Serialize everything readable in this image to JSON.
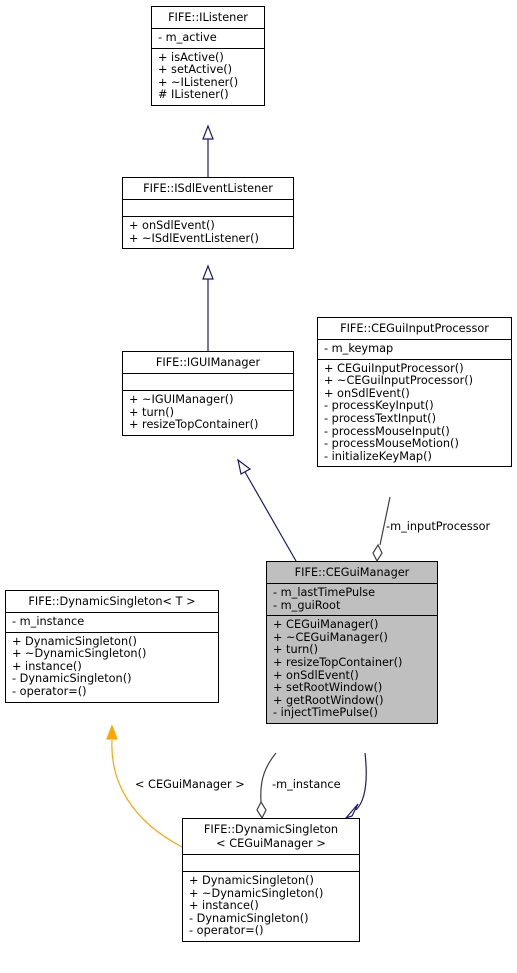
{
  "classes": {
    "ilistener": {
      "name": "FIFE::IListener",
      "attributes": [
        "- m_active"
      ],
      "methods": [
        "+ isActive()",
        "+ setActive()",
        "+ ~IListener()",
        "# IListener()"
      ]
    },
    "isdleventlistener": {
      "name": "FIFE::ISdlEventListener",
      "attributes": [],
      "methods": [
        "+ onSdlEvent()",
        "+ ~ISdlEventListener()"
      ]
    },
    "iguimanager": {
      "name": "FIFE::IGUIManager",
      "attributes": [],
      "methods": [
        "+ ~IGUIManager()",
        "+ turn()",
        "+ resizeTopContainer()"
      ]
    },
    "ceguiinputprocessor": {
      "name": "FIFE::CEGuiInputProcessor",
      "attributes": [
        "- m_keymap"
      ],
      "methods": [
        "+ CEGuiInputProcessor()",
        "+ ~CEGuiInputProcessor()",
        "+ onSdlEvent()",
        "- processKeyInput()",
        "- processTextInput()",
        "- processMouseInput()",
        "- processMouseMotion()",
        "- initializeKeyMap()"
      ]
    },
    "ceguimanager": {
      "name": "FIFE::CEGuiManager",
      "attributes": [
        "- m_lastTimePulse",
        "- m_guiRoot"
      ],
      "methods": [
        "+ CEGuiManager()",
        "+ ~CEGuiManager()",
        "+ turn()",
        "+ resizeTopContainer()",
        "+ onSdlEvent()",
        "+ setRootWindow()",
        "+ getRootWindow()",
        "- injectTimePulse()"
      ]
    },
    "dynamicsingleton_t": {
      "name": "FIFE::DynamicSingleton< T >",
      "attributes": [
        "- m_instance"
      ],
      "methods": [
        "+ DynamicSingleton()",
        "+ ~DynamicSingleton()",
        "+ instance()",
        "- DynamicSingleton()",
        "- operator=()"
      ]
    },
    "dynamicsingleton_cegui": {
      "name_line1": "FIFE::DynamicSingleton",
      "name_line2": "< CEGuiManager >",
      "attributes": [],
      "methods": [
        "+ DynamicSingleton()",
        "+ ~DynamicSingleton()",
        "+ instance()",
        "- DynamicSingleton()",
        "- operator=()"
      ]
    }
  },
  "edges": {
    "input_processor_label": "-m_inputProcessor",
    "template_label": "< CEGuiManager >",
    "instance_label": "-m_instance"
  },
  "colors": {
    "inheritance": "#191970",
    "template": "#ffa500",
    "association": "#404040",
    "focus_fill": "#bfbfbf"
  }
}
